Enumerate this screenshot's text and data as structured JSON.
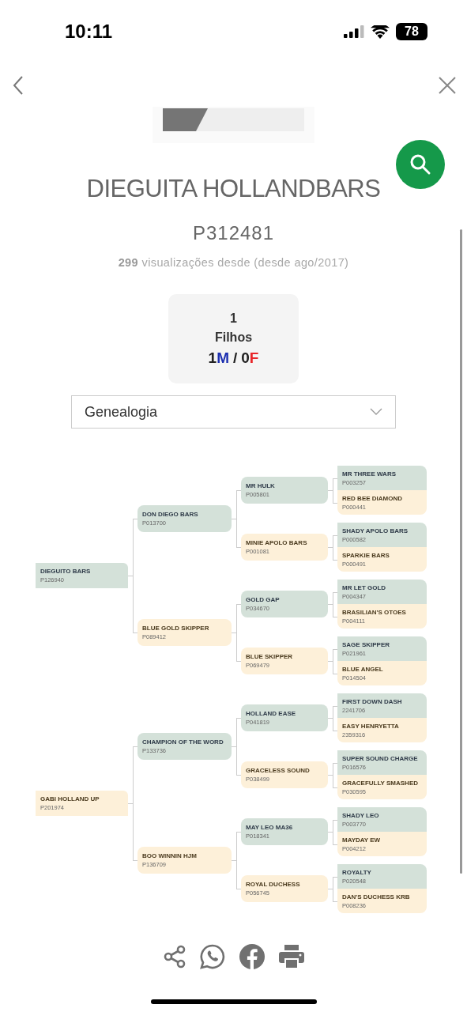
{
  "status_bar": {
    "time": "10:11",
    "battery": "78"
  },
  "horse": {
    "name": "DIEGUITA HOLLANDBARS",
    "registration": "P312481",
    "views": "**299** visualizações desde  (desde ago/2017)"
  },
  "offspring": {
    "count": "1",
    "label": "Filhos",
    "separator": "/",
    "sexes": [
      {
        "count": "1",
        "letter": "M",
        "color": "#1c2fb0"
      },
      {
        "count": "0",
        "letter": "F",
        "color": "#e8262a"
      }
    ]
  },
  "section_select": {
    "value": "Genealogia"
  },
  "pedigree": [
    {
      "name": "DIEGUITO BARS",
      "reg": "P126940",
      "kind": "male",
      "children": [
        {
          "name": "DON DIEGO BARS",
          "reg": "P013700",
          "kind": "male",
          "children": [
            {
              "name": "MR HULK",
              "reg": "P005801",
              "kind": "male",
              "children": [
                {
                  "name": "MR THREE WARS",
                  "reg": "P003257",
                  "kind": "male"
                },
                {
                  "name": "RED BEE DIAMOND",
                  "reg": "P000441",
                  "kind": "female"
                }
              ]
            },
            {
              "name": "MINIE APOLO BARS",
              "reg": "P001081",
              "kind": "female",
              "children": [
                {
                  "name": "SHADY APOLO BARS",
                  "reg": "P000582",
                  "kind": "male"
                },
                {
                  "name": "SPARKIE BARS",
                  "reg": "P000491",
                  "kind": "female"
                }
              ]
            }
          ]
        },
        {
          "name": "BLUE GOLD SKIPPER",
          "reg": "P089412",
          "kind": "female",
          "children": [
            {
              "name": "GOLD GAP",
              "reg": "P034670",
              "kind": "male",
              "children": [
                {
                  "name": "MR LET GOLD",
                  "reg": "P004347",
                  "kind": "male"
                },
                {
                  "name": "BRASILIAN'S OTOES",
                  "reg": "P004111",
                  "kind": "female"
                }
              ]
            },
            {
              "name": "BLUE SKIPPER",
              "reg": "P069479",
              "kind": "female",
              "children": [
                {
                  "name": "SAGE SKIPPER",
                  "reg": "P021961",
                  "kind": "male"
                },
                {
                  "name": "BLUE ANGEL",
                  "reg": "P014504",
                  "kind": "female"
                }
              ]
            }
          ]
        }
      ]
    },
    {
      "name": "GABI HOLLAND UP",
      "reg": "P201974",
      "kind": "female",
      "children": [
        {
          "name": "CHAMPION OF THE WORD",
          "reg": "P133736",
          "kind": "male",
          "children": [
            {
              "name": "HOLLAND EASE",
              "reg": "P041819",
              "kind": "male",
              "children": [
                {
                  "name": "FIRST DOWN DASH",
                  "reg": "2241706",
                  "kind": "male"
                },
                {
                  "name": "EASY HENRYETTA",
                  "reg": "2359316",
                  "kind": "female"
                }
              ]
            },
            {
              "name": "GRACELESS SOUND",
              "reg": "P038499",
              "kind": "female",
              "children": [
                {
                  "name": "SUPER SOUND CHARGE",
                  "reg": "P016576",
                  "kind": "male"
                },
                {
                  "name": "GRACEFULLY SMASHED",
                  "reg": "P030595",
                  "kind": "female"
                }
              ]
            }
          ]
        },
        {
          "name": "BOO WINNIN HJM",
          "reg": "P136709",
          "kind": "female",
          "children": [
            {
              "name": "MAY LEO MA36",
              "reg": "P018341",
              "kind": "male",
              "children": [
                {
                  "name": "SHADY LEO",
                  "reg": "P003770",
                  "kind": "male"
                },
                {
                  "name": "MAYDAY EW",
                  "reg": "P004212",
                  "kind": "female"
                }
              ]
            },
            {
              "name": "ROYAL DUCHESS",
              "reg": "P056745",
              "kind": "female",
              "children": [
                {
                  "name": "ROYALTY",
                  "reg": "P020548",
                  "kind": "male"
                },
                {
                  "name": "DAN'S DUCHESS KRB",
                  "reg": "P008236",
                  "kind": "female"
                }
              ]
            }
          ]
        }
      ]
    }
  ]
}
